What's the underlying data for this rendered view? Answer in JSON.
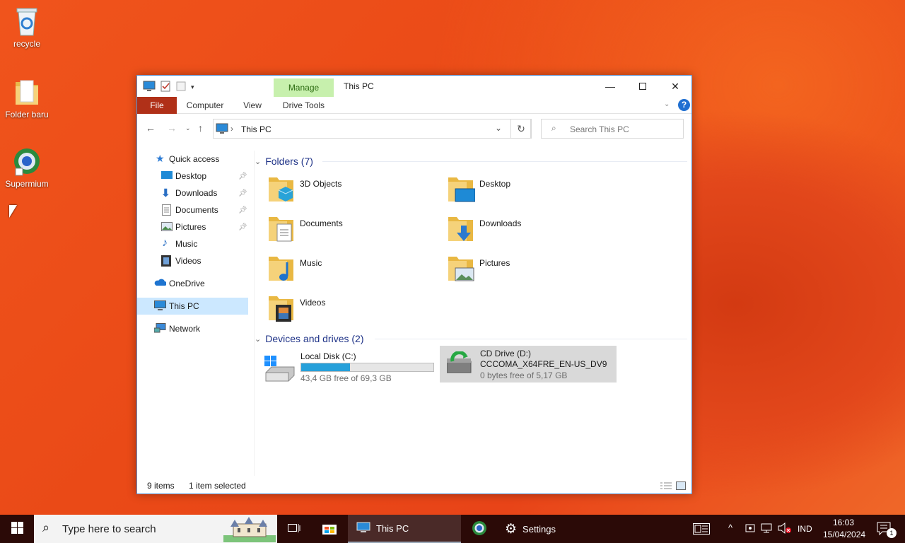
{
  "desktop": {
    "icons": [
      {
        "label": "recycle",
        "icon": "recycle-bin-icon"
      },
      {
        "label": "Folder baru",
        "icon": "folder-icon"
      },
      {
        "label": "Supermium",
        "icon": "browser-icon"
      }
    ]
  },
  "window": {
    "title": "This PC",
    "context_tab": "Manage",
    "ribbon_tabs": [
      "File",
      "Computer",
      "View",
      "Drive Tools"
    ],
    "address": "This PC",
    "search_placeholder": "Search This PC"
  },
  "nav": {
    "quick_access": "Quick access",
    "items": [
      {
        "label": "Desktop",
        "icon": "desktop-icon",
        "pinned": true
      },
      {
        "label": "Downloads",
        "icon": "download-icon",
        "pinned": true
      },
      {
        "label": "Documents",
        "icon": "document-icon",
        "pinned": true
      },
      {
        "label": "Pictures",
        "icon": "pictures-icon",
        "pinned": true
      },
      {
        "label": "Music",
        "icon": "music-icon",
        "pinned": false
      },
      {
        "label": "Videos",
        "icon": "videos-icon",
        "pinned": false
      }
    ],
    "onedrive": "OneDrive",
    "this_pc": "This PC",
    "network": "Network"
  },
  "content": {
    "folders_header": "Folders (7)",
    "folders": [
      "3D Objects",
      "Desktop",
      "Documents",
      "Downloads",
      "Music",
      "Pictures",
      "Videos"
    ],
    "devices_header": "Devices and drives (2)",
    "drives": [
      {
        "name": "Local Disk (C:)",
        "free": "43,4 GB free of 69,3 GB",
        "used_fraction": 0.37
      },
      {
        "name": "CD Drive (D:)",
        "label": "CCCOMA_X64FRE_EN-US_DV9",
        "free": "0 bytes free of 5,17 GB"
      }
    ]
  },
  "status": {
    "items": "9 items",
    "selected": "1 item selected"
  },
  "taskbar": {
    "search_placeholder": "Type here to search",
    "apps": [
      {
        "label": "This PC"
      },
      {
        "label": "Settings"
      }
    ],
    "lang": "IND",
    "time": "16:03",
    "date": "15/04/2024",
    "notifications": "1"
  },
  "colors": {
    "accent": "#26a0da",
    "file_tab": "#b03018",
    "manage_tab": "#c7f0ad",
    "selection": "#cce8ff"
  }
}
